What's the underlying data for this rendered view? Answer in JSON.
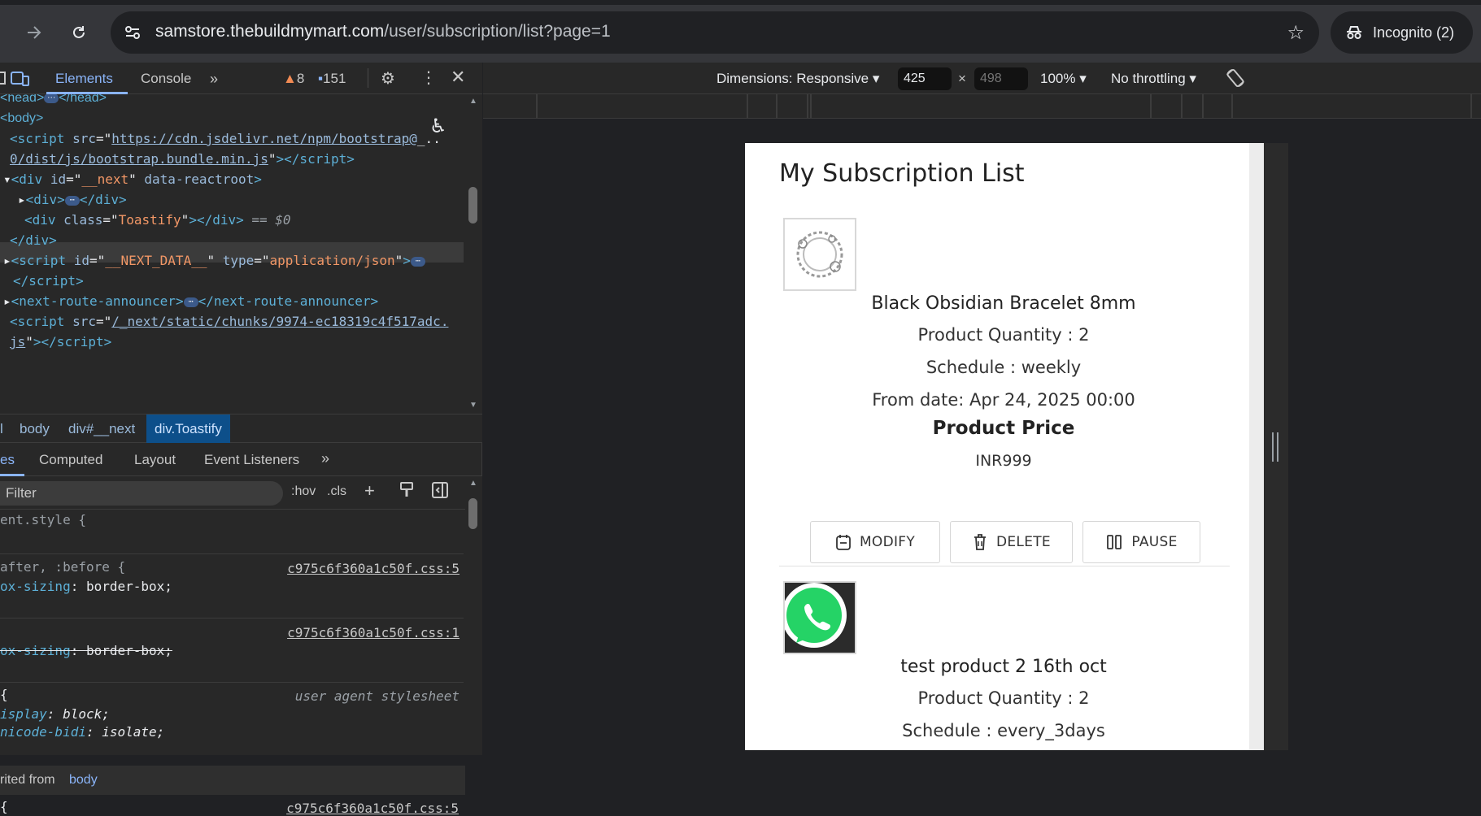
{
  "browser": {
    "url_host": "samstore.thebuildmymart.com",
    "url_path": "/user/subscription/list?page=1",
    "incognito_label": "Incognito (2)"
  },
  "devtools": {
    "tabs": [
      "Elements",
      "Console"
    ],
    "warnings": "8",
    "messages": "151",
    "dom": {
      "head_open": "<head>",
      "head_close": "</head>",
      "body": "<body>",
      "script_src_1": "https://cdn.jsdelivr.net/npm/bootstrap@",
      "script_src_1b": "0/dist/js/bootstrap.bundle.min.js",
      "div_id": "__next",
      "div_attr": "data-reactroot",
      "div_class": "Toastify",
      "dollar": "== $0",
      "script_id": "__NEXT_DATA__",
      "script_type": "application/json",
      "next_route": "next-route-announcer",
      "script_src_2": "/_next/static/chunks/9974-ec18319c4f517adc.",
      "script_src_2b": "js"
    },
    "breadcrumbs": [
      "l",
      "body",
      "div#__next",
      "div.Toastify"
    ],
    "styles_tabs": [
      "es",
      "Computed",
      "Layout",
      "Event Listeners"
    ],
    "filter_placeholder": "Filter",
    "filter_tools": [
      ":hov",
      ".cls"
    ],
    "styles": {
      "element_style": "ent.style {",
      "rule1_sel": "after, :before {",
      "rule1_src": "c975c6f360a1c50f.css:5",
      "rule1_prop": "ox-sizing",
      "rule1_val": "border-box;",
      "rule2_src": "c975c6f360a1c50f.css:1",
      "rule2_prop": "ox-sizing",
      "rule2_val": "border-box;",
      "rule3_sel": "{",
      "rule3_src": "user agent stylesheet",
      "rule3_p1": "isplay",
      "rule3_v1": "block;",
      "rule3_p2": "nicode-bidi",
      "rule3_v2": "isolate;",
      "inherited_prefix": "rited from",
      "inherited_el": "body",
      "rule4_sel": "{",
      "rule4_src": "c975c6f360a1c50f.css:5"
    }
  },
  "device_toolbar": {
    "dimensions_label": "Dimensions: Responsive",
    "width": "425",
    "height": "498",
    "zoom": "100%",
    "throttling": "No throttling"
  },
  "page": {
    "title": "My Subscription List",
    "items": [
      {
        "name": "Black Obsidian Bracelet 8mm",
        "quantity": "Product Quantity : 2",
        "schedule": "Schedule : weekly",
        "from_date": "From date: Apr 24, 2025 00:00",
        "price_label": "Product Price",
        "price": "INR999"
      },
      {
        "name": "test product 2 16th oct",
        "quantity": "Product Quantity : 2",
        "schedule": "Schedule : every_3days"
      }
    ],
    "actions": {
      "modify": "MODIFY",
      "delete": "DELETE",
      "pause": "PAUSE"
    }
  }
}
